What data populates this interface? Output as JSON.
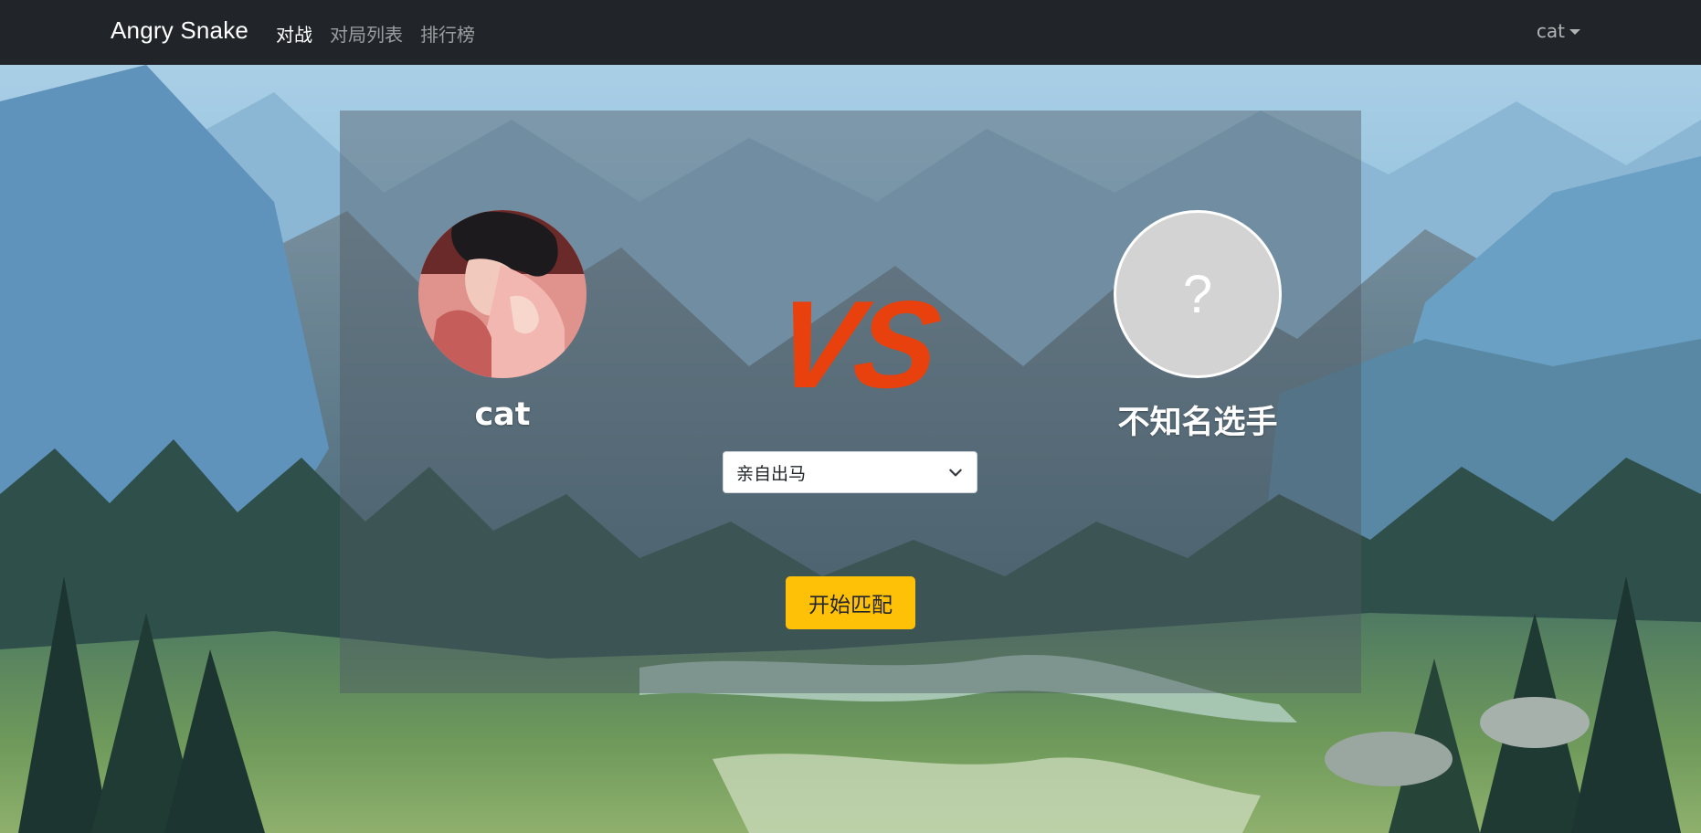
{
  "navbar": {
    "brand": "Angry Snake",
    "links": [
      {
        "label": "对战",
        "active": true
      },
      {
        "label": "对局列表",
        "active": false
      },
      {
        "label": "排行榜",
        "active": false
      }
    ],
    "user": "cat"
  },
  "match": {
    "self": {
      "name": "cat",
      "avatar": "user-avatar-illustration"
    },
    "opponent": {
      "name": "不知名选手",
      "avatar_placeholder": "?"
    },
    "vs_text": "VS",
    "bot_select": {
      "selected": "亲自出马"
    },
    "start_button": "开始匹配"
  },
  "colors": {
    "navbar_bg": "#212529",
    "vs": "#e8410d",
    "start_button": "#ffc107"
  }
}
